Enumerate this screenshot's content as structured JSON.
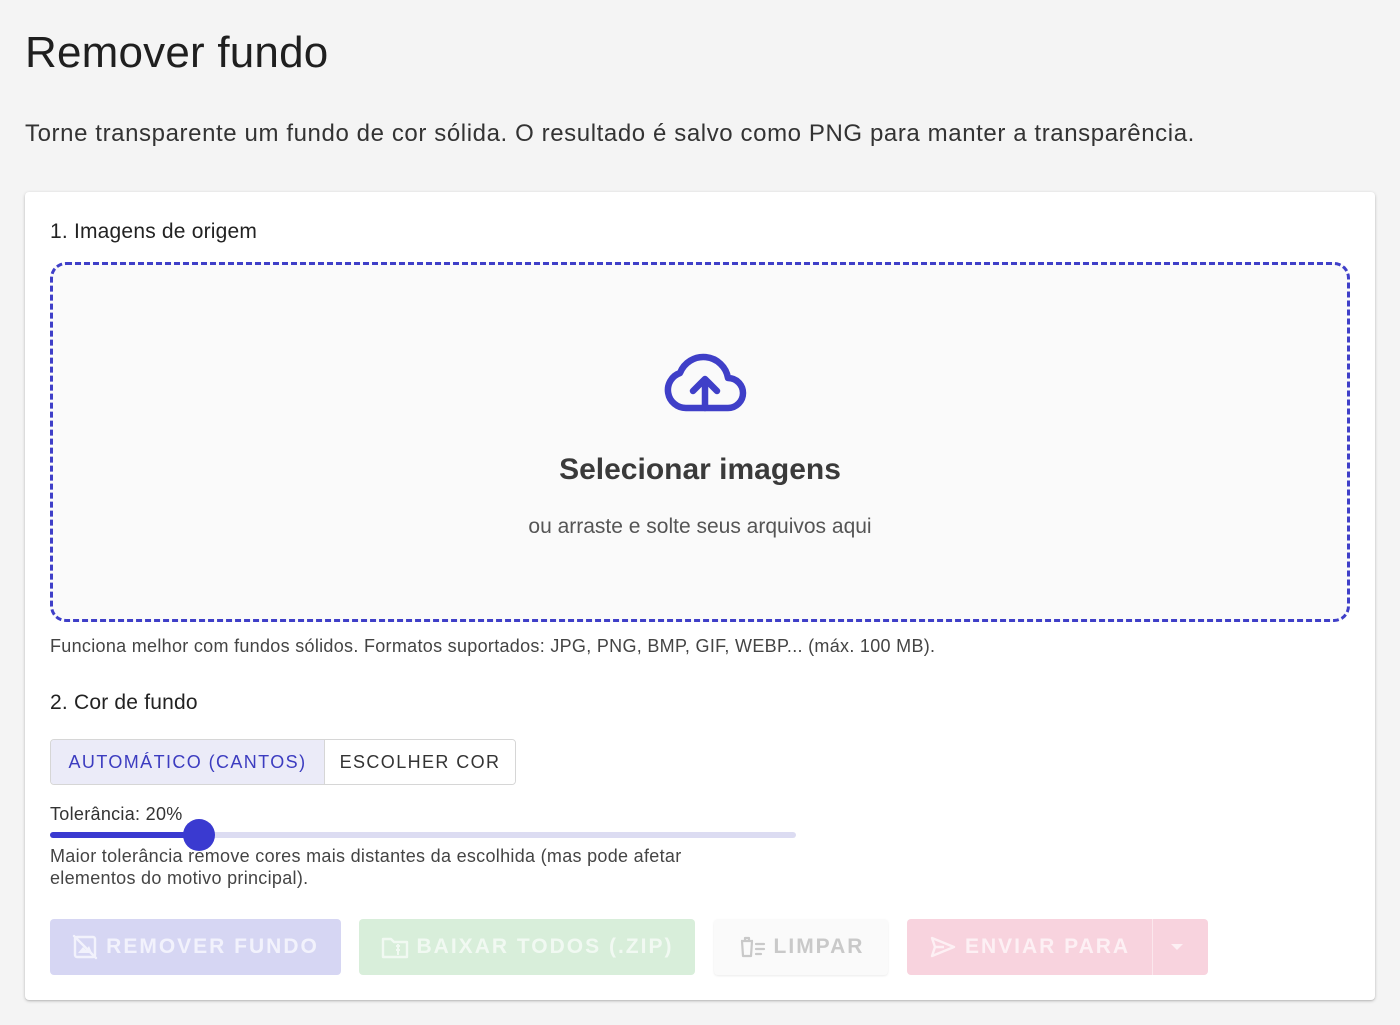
{
  "page": {
    "title": "Remover fundo",
    "description": "Torne transparente um fundo de cor sólida. O resultado é salvo como PNG para manter a transparência."
  },
  "source": {
    "section_title": "1. Imagens de origem",
    "dropzone_title": "Selecionar imagens",
    "dropzone_subtitle": "ou arraste e solte seus arquivos aqui",
    "hint": "Funciona melhor com fundos sólidos. Formatos suportados: JPG, PNG, BMP, GIF, WEBP... (máx. 100 MB).",
    "icon": "cloud-upload-icon"
  },
  "background": {
    "section_title": "2. Cor de fundo",
    "modes": [
      {
        "label": "AUTOMÁTICO (CANTOS)",
        "selected": true
      },
      {
        "label": "ESCOLHER COR",
        "selected": false
      }
    ],
    "tolerance_label": "Tolerância: 20%",
    "tolerance_percent": 20,
    "tolerance_help": "Maior tolerância remove cores mais distantes da escolhida (mas pode afetar elementos do motivo principal)."
  },
  "actions": {
    "remove_label": "REMOVER FUNDO",
    "download_zip_label": "BAIXAR TODOS (.ZIP)",
    "clear_label": "LIMPAR",
    "send_to_label": "ENVIAR PARA",
    "disabled": true
  },
  "colors": {
    "accent": "#3a3ad0",
    "remove_disabled": "#d6d6f3",
    "download_disabled": "#d8eeda",
    "send_disabled": "#f8d3de"
  }
}
